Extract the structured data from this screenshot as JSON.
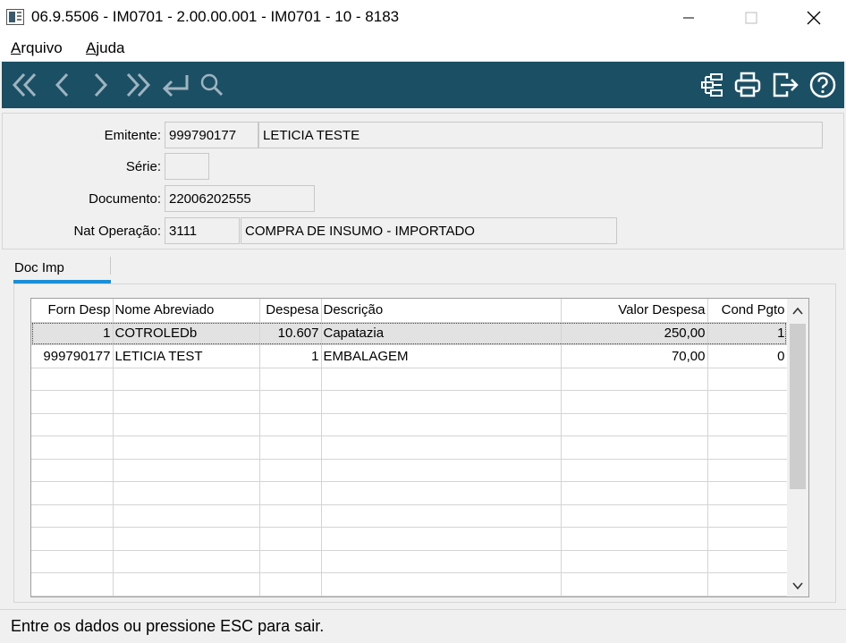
{
  "window": {
    "title": "06.9.5506 - IM0701 - 2.00.00.001 - IM0701 - 10 - 8183",
    "app_icon": "program-window-icon",
    "controls": [
      "minimize-icon",
      "maximize-icon",
      "close-icon"
    ]
  },
  "menu": {
    "items": [
      {
        "label": "Arquivo",
        "first": "A",
        "rest": "rquivo"
      },
      {
        "label": "Ajuda",
        "first": "A",
        "rest": "juda"
      }
    ]
  },
  "toolbar": {
    "background": "#1b4f64",
    "left_icons": [
      "first-record-icon",
      "previous-record-icon",
      "next-record-icon",
      "last-record-icon",
      "go-to-icon",
      "search-icon"
    ],
    "right_icons": [
      "structure-tree-icon",
      "print-icon",
      "exit-icon",
      "help-icon"
    ]
  },
  "header": {
    "emitente": {
      "label": "Emitente:",
      "code": "999790177",
      "name": "LETICIA TESTE"
    },
    "serie": {
      "label": "Série:",
      "value": ""
    },
    "documento": {
      "label": "Documento:",
      "value": "22006202555"
    },
    "nat_operacao": {
      "label": "Nat Operação:",
      "code": "3111",
      "description": "COMPRA DE INSUMO - IMPORTADO"
    }
  },
  "tabs": [
    {
      "label": "Doc Imp",
      "active": true
    }
  ],
  "grid": {
    "columns": [
      "Forn Desp",
      "Nome Abreviado",
      "Despesa",
      "Descrição",
      "Valor Despesa",
      "Cond Pgto"
    ],
    "rows": [
      [
        "1",
        "COTROLEDb",
        "10.607",
        "Capatazia",
        "250,00",
        "1"
      ],
      [
        "999790177",
        "LETICIA TEST",
        "1",
        "EMBALAGEM",
        "70,00",
        "0"
      ]
    ],
    "selected_row": 0
  },
  "status": {
    "text": "Entre os dados ou pressione ESC para sair."
  }
}
